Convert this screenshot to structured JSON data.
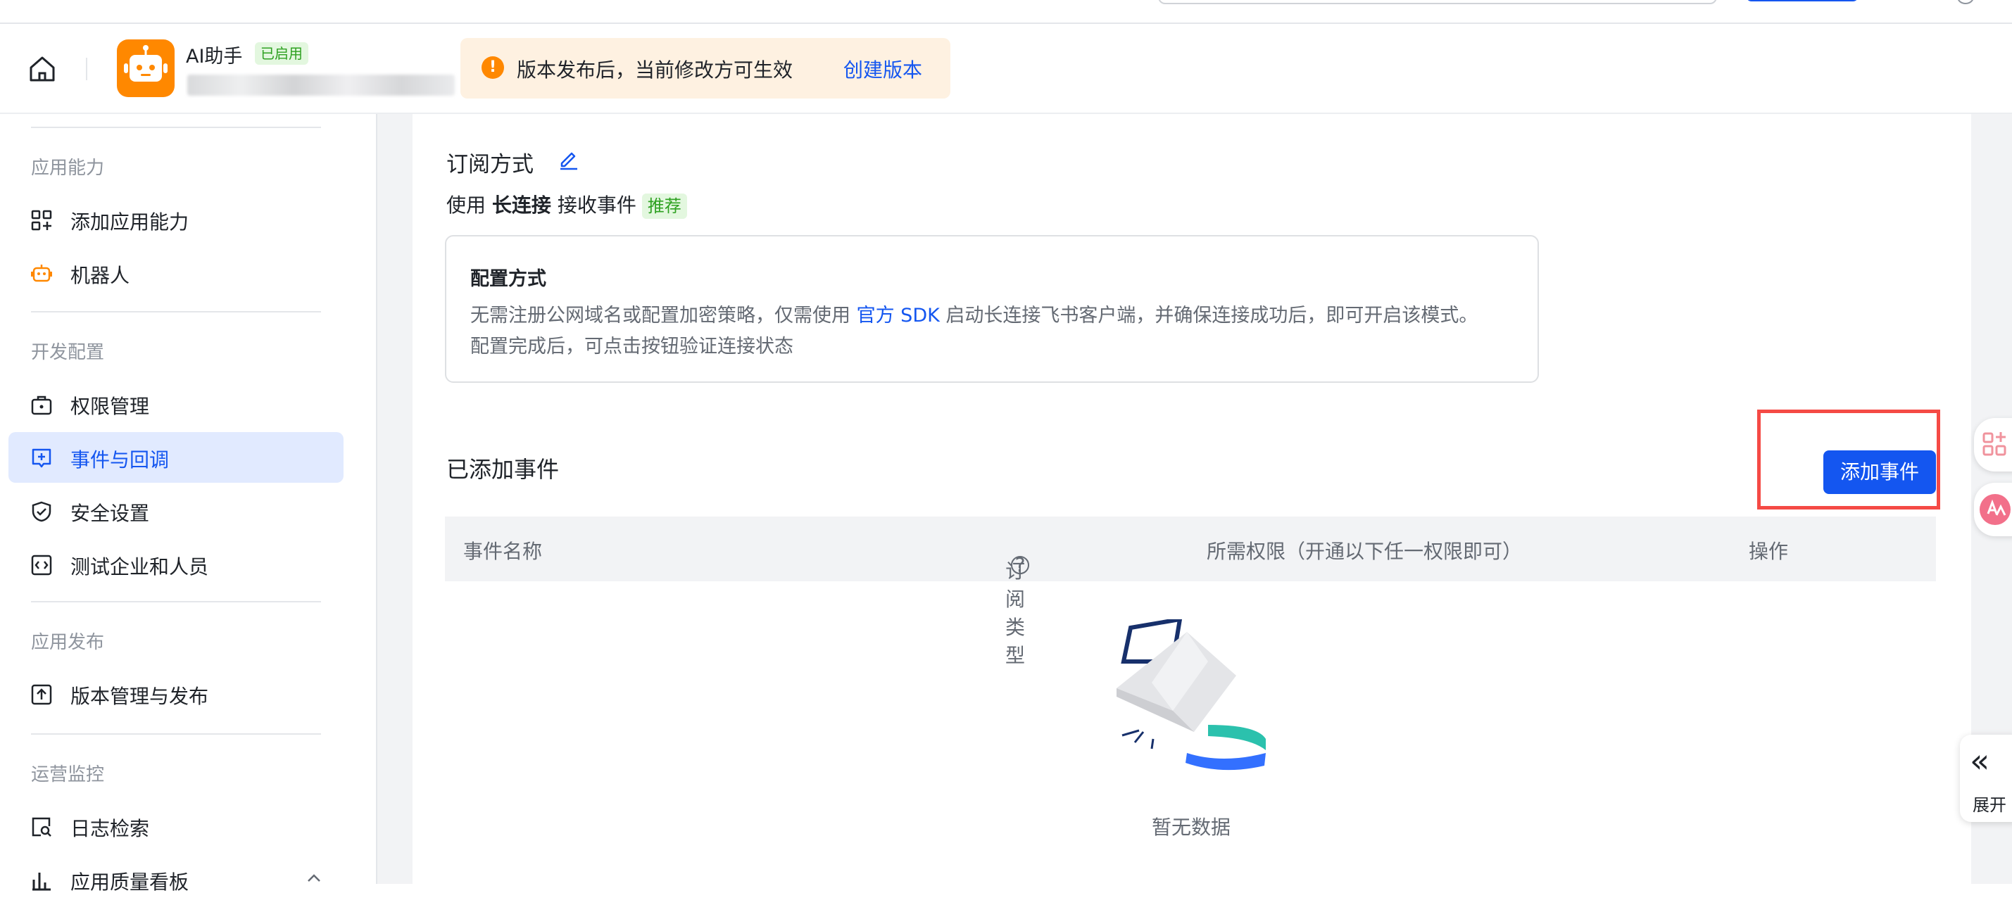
{
  "header": {
    "app_name": "AI助手",
    "status_badge": "已启用",
    "notice_text": "版本发布后，当前修改方可生效",
    "notice_link": "创建版本",
    "notice_icon": "warning-icon"
  },
  "sidebar": {
    "groups": [
      {
        "title": "应用能力",
        "items": [
          {
            "label": "添加应用能力",
            "icon": "grid-plus-icon"
          },
          {
            "label": "机器人",
            "icon": "robot-icon"
          }
        ]
      },
      {
        "title": "开发配置",
        "items": [
          {
            "label": "权限管理",
            "icon": "lock-box-icon"
          },
          {
            "label": "事件与回调",
            "icon": "event-icon",
            "active": true
          },
          {
            "label": "安全设置",
            "icon": "shield-icon"
          },
          {
            "label": "测试企业和人员",
            "icon": "code-icon"
          }
        ]
      },
      {
        "title": "应用发布",
        "items": [
          {
            "label": "版本管理与发布",
            "icon": "upload-icon"
          }
        ]
      },
      {
        "title": "运营监控",
        "items": [
          {
            "label": "日志检索",
            "icon": "log-search-icon"
          },
          {
            "label": "应用质量看板",
            "icon": "bar-chart-icon"
          }
        ]
      }
    ]
  },
  "main": {
    "subscription": {
      "title": "订阅方式",
      "mode_prefix": "使用",
      "mode_value": "长连接",
      "mode_suffix": "接收事件",
      "mode_tag": "推荐"
    },
    "config": {
      "title": "配置方式",
      "desc_part1": "无需注册公网域名或配置加密策略，仅需使用",
      "desc_link": "官方 SDK",
      "desc_part2": "启动长连接飞书客户端，并确保连接成功后，即可开启该模式。",
      "desc_line2": "配置完成后，可点击按钮验证连接状态"
    },
    "events": {
      "title": "已添加事件",
      "add_button": "添加事件",
      "columns": [
        "事件名称",
        "订阅类型",
        "所需权限（开通以下任一权限即可）",
        "操作"
      ],
      "help_glyph": "?",
      "empty_text": "暂无数据"
    }
  },
  "floating": {
    "expand_label": "展开",
    "expand_glyph": "«"
  },
  "colors": {
    "accent": "#1456f0",
    "active_bg": "#e1eaff",
    "warning": "#ff8800",
    "success": "#2ea121",
    "highlight_box": "#f54a45"
  }
}
